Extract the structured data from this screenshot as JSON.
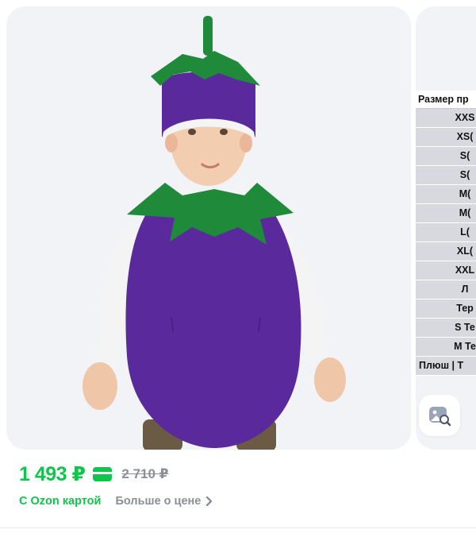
{
  "gallery": {
    "photo_alt": "Eggplant costume",
    "size_table": {
      "header": "Размер пр",
      "rows": [
        "XXS",
        "XS(",
        "S(",
        "S(",
        "M(",
        "M(",
        "L(",
        "XL(",
        "XXL",
        "Л",
        "Тер",
        "S Те",
        "M Те",
        "Плюш | Т"
      ]
    }
  },
  "price": {
    "current": "1 493 ₽",
    "old": "2 710 ₽",
    "ozon_card_label": "С Ozon картой",
    "more_label": "Больше о цене"
  },
  "colors": {
    "accent_green": "#10c44c",
    "muted": "#8a8f98",
    "costume_purple": "#5a2a9c",
    "leaf_green": "#1f8a3a"
  },
  "icons": {
    "search_similar": "image-search-icon",
    "card": "card-icon",
    "chevron": "chevron-right-icon"
  }
}
